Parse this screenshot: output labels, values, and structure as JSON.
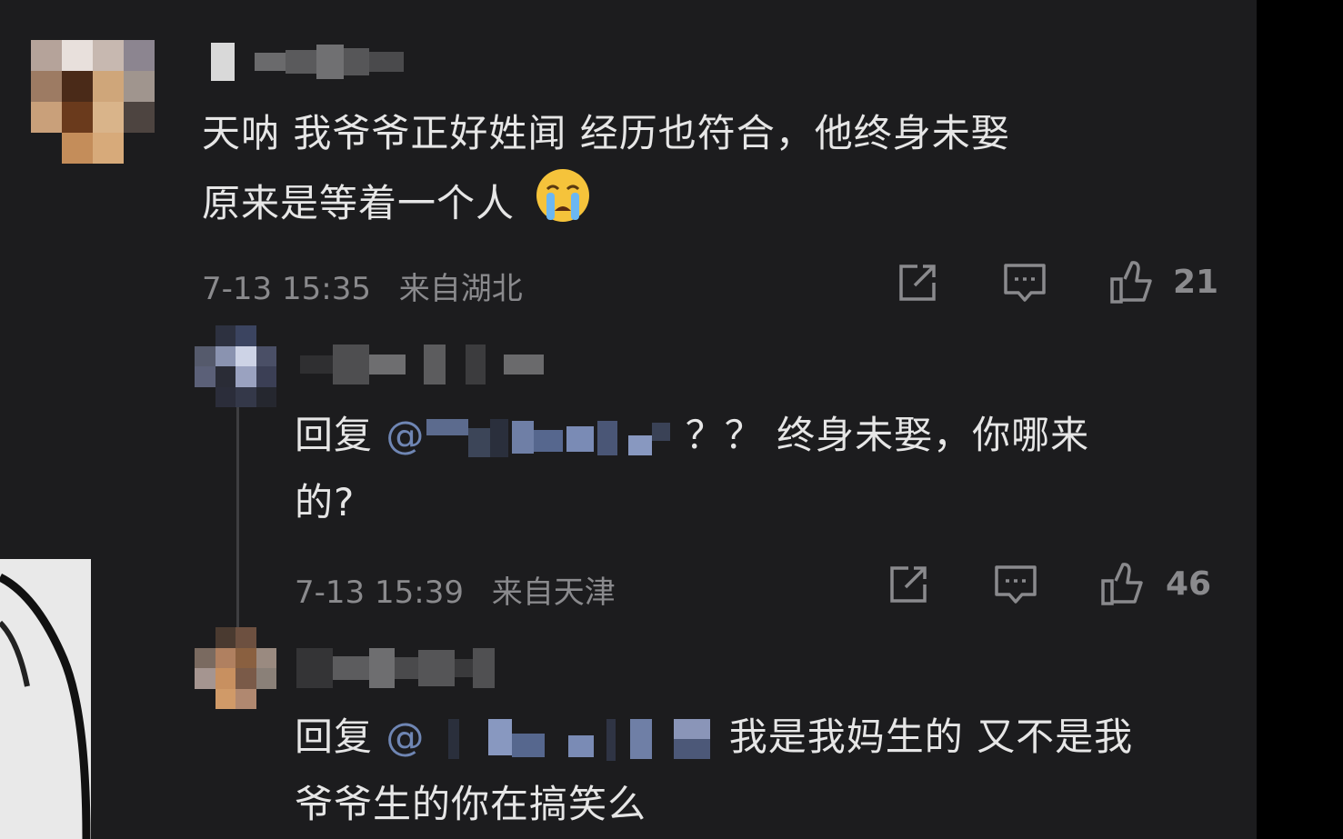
{
  "comments": [
    {
      "text_line1": "天呐 我爷爷正好姓闻 经历也符合，他终身未娶",
      "text_line2": "原来是等着一个人",
      "emoji": "crying-face",
      "time": "7-13 15:35",
      "location": "来自湖北",
      "likes": "21"
    },
    {
      "reply_prefix": "回复",
      "at": "@",
      "text_line1_rest": "？？ 终身未娶，你哪来",
      "text_line2": "的?",
      "time": "7-13 15:39",
      "location": "来自天津",
      "likes": "46"
    },
    {
      "reply_prefix": "回复",
      "at": "@",
      "text_line1_rest": "我是我妈生的 又不是我",
      "text_line2": "爷爷生的你在搞笑么"
    }
  ],
  "icons": {
    "share": "share-icon",
    "comment": "comment-icon",
    "like": "thumbs-up-icon"
  },
  "colors": {
    "background": "#1c1c1e",
    "text": "#e6e6e6",
    "meta": "#8a8a8d",
    "mention": "#6f86b4"
  }
}
